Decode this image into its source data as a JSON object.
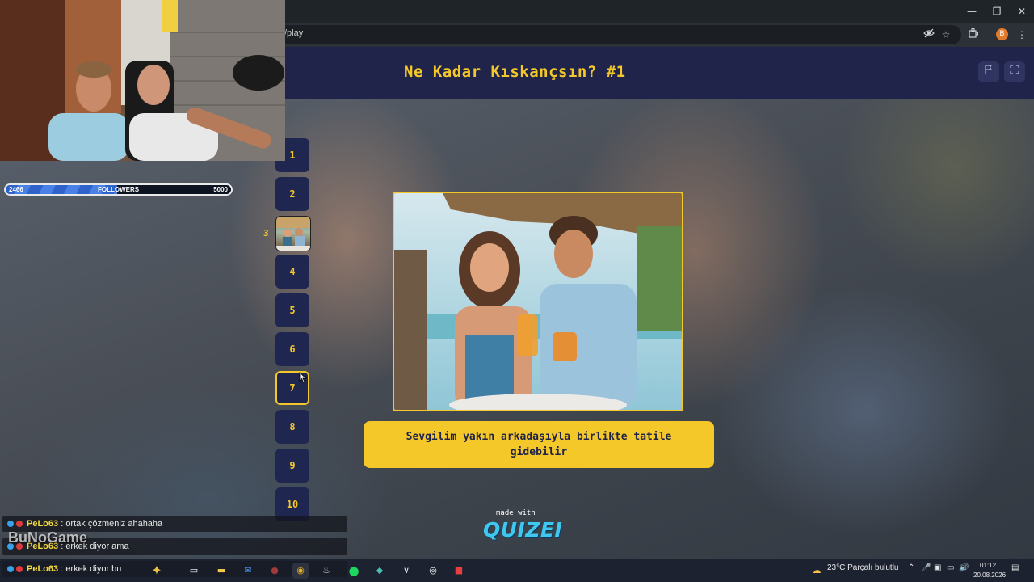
{
  "browser": {
    "url_fragment": "/play",
    "window_controls": [
      "—",
      "❐",
      "✕"
    ],
    "profile_initial": "B"
  },
  "quiz": {
    "title": "Ne Kadar Kıskançsın? #1",
    "current_index": 3,
    "questions": [
      "1",
      "2",
      "3",
      "4",
      "5",
      "6",
      "7",
      "8",
      "9",
      "10"
    ],
    "question_text": "Sevgilim yakın arkadaşıyla birlikte tatile gidebilir",
    "made_with": "made with",
    "brand": "QUIZEI",
    "accent_color": "#f5c82a",
    "header_color": "#20244a"
  },
  "stream": {
    "followers": {
      "current": "2466",
      "label": "FOLLOWERS",
      "goal": "5000",
      "progress": 0.4932
    },
    "watermark": "BuNoGame",
    "chat": [
      {
        "user": "PeLo63",
        "text": "ortak çözmeniz ahahaha"
      },
      {
        "user": "PeLo63",
        "text": "erkek diyor ama"
      },
      {
        "user": "PeLo63",
        "text": "erkek diyor bu"
      }
    ]
  },
  "taskbar": {
    "weather": "23°C  Parçalı bulutlu",
    "time": "01:12",
    "date": "20.08.2026"
  }
}
